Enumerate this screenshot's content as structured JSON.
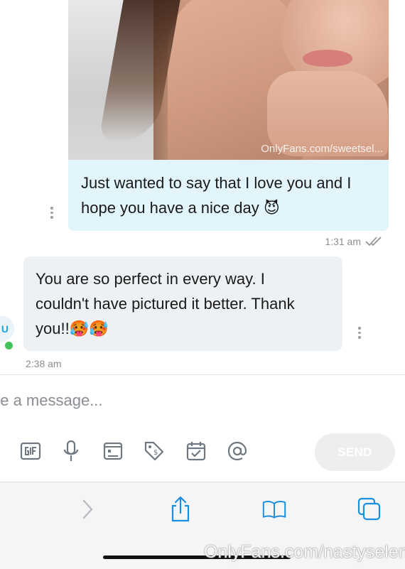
{
  "photo_message": {
    "watermark": "OnlyFans.com/sweetsel..."
  },
  "outgoing_message": {
    "text_line1": "Just wanted to say that I love you and I",
    "text_line2": "hope you have a nice day",
    "emoji": "😈",
    "time": "1:31 am",
    "status_icon": "double-check-icon"
  },
  "incoming_message": {
    "text_line1": "You are so perfect in every way. I",
    "text_line2": "couldn't have pictured it better. Thank",
    "text_line3": "you!!",
    "emojis": "🥵🥵",
    "time": "2:38 am",
    "avatar_initial": "U",
    "online_color": "#43c35a"
  },
  "composer": {
    "placeholder": "pe a message...",
    "send_label": "SEND",
    "tools": [
      "gif-icon",
      "microphone-icon",
      "image-icon",
      "price-tag-icon",
      "calendar-icon",
      "at-sign-icon"
    ]
  },
  "safari_toolbar": {
    "buttons": [
      "forward-icon",
      "share-icon",
      "bookmarks-icon",
      "tabs-icon"
    ]
  },
  "watermark_bottom": "OnlyFans.com/nastyselene",
  "colors": {
    "accent": "#1a8fe0",
    "outgoing_bubble": "#e2f4fc",
    "incoming_bubble": "#eef1f3"
  }
}
